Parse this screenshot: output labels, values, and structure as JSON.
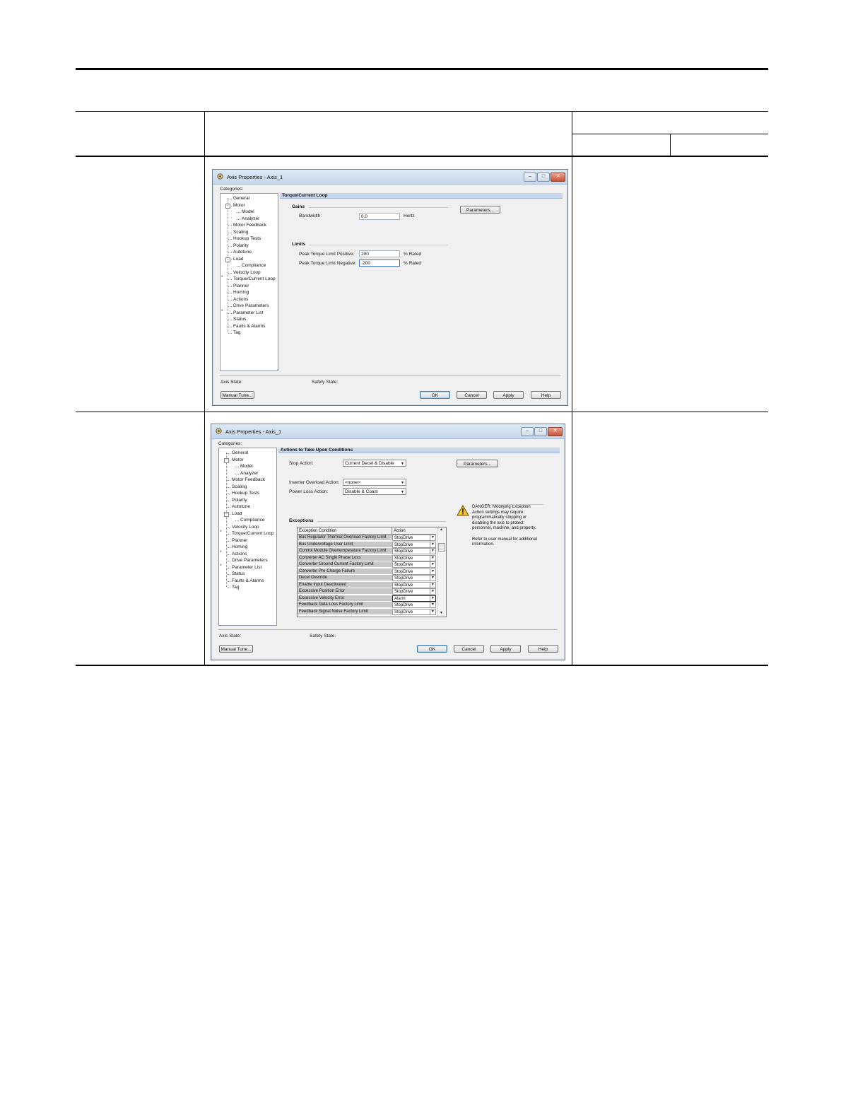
{
  "dialog1": {
    "title": "Axis Properties - Axis_1",
    "categories_label": "Categories:",
    "tree": [
      {
        "label": "General",
        "level": 1
      },
      {
        "label": "Motor",
        "level": 1,
        "expander": "-"
      },
      {
        "label": "Model",
        "level": 2
      },
      {
        "label": "Analyzer",
        "level": 2
      },
      {
        "label": "Motor Feedback",
        "level": 1
      },
      {
        "label": "Scaling",
        "level": 1
      },
      {
        "label": "Hookup Tests",
        "level": 1
      },
      {
        "label": "Polarity",
        "level": 1
      },
      {
        "label": "Autotune",
        "level": 1
      },
      {
        "label": "Load",
        "level": 1,
        "expander": "-"
      },
      {
        "label": "Compliance",
        "level": 2
      },
      {
        "label": "Velocity Loop",
        "level": 1
      },
      {
        "label": "Torque/Current Loop",
        "level": 1,
        "star": true
      },
      {
        "label": "Planner",
        "level": 1
      },
      {
        "label": "Homing",
        "level": 1
      },
      {
        "label": "Actions",
        "level": 1
      },
      {
        "label": "Drive Parameters",
        "level": 1
      },
      {
        "label": "Parameter List",
        "level": 1,
        "star": true
      },
      {
        "label": "Status",
        "level": 1
      },
      {
        "label": "Faults & Alarms",
        "level": 1
      },
      {
        "label": "Tag",
        "level": 1
      }
    ],
    "section_title": "Torque/Current Loop",
    "gains_label": "Gains",
    "bandwidth_label": "Bandwidth:",
    "bandwidth_value": "0.0",
    "bandwidth_unit": "Hertz",
    "parameters_button": "Parameters...",
    "limits_label": "Limits",
    "peak_pos_label": "Peak Torque Limit Positive:",
    "peak_pos_value": "200",
    "peak_pos_unit": "% Rated",
    "peak_neg_label": "Peak Torque Limit Negative:",
    "peak_neg_value": "-200",
    "peak_neg_unit": "% Rated",
    "axis_state_label": "Axis State:",
    "safety_state_label": "Safety State:",
    "manual_tune_button": "Manual Tune...",
    "ok_button": "OK",
    "cancel_button": "Cancel",
    "apply_button": "Apply",
    "help_button": "Help"
  },
  "dialog2": {
    "title": "Axis Properties - Axis_1",
    "categories_label": "Categories:",
    "tree": [
      {
        "label": "General",
        "level": 1
      },
      {
        "label": "Motor",
        "level": 1,
        "expander": "-"
      },
      {
        "label": "Model",
        "level": 2
      },
      {
        "label": "Analyzer",
        "level": 2
      },
      {
        "label": "Motor Feedback",
        "level": 1
      },
      {
        "label": "Scaling",
        "level": 1
      },
      {
        "label": "Hookup Tests",
        "level": 1
      },
      {
        "label": "Polarity",
        "level": 1
      },
      {
        "label": "Autotune",
        "level": 1
      },
      {
        "label": "Load",
        "level": 1,
        "expander": "-"
      },
      {
        "label": "Compliance",
        "level": 2
      },
      {
        "label": "Velocity Loop",
        "level": 1
      },
      {
        "label": "Torque/Current Loop",
        "level": 1,
        "star": true
      },
      {
        "label": "Planner",
        "level": 1
      },
      {
        "label": "Homing",
        "level": 1
      },
      {
        "label": "Actions",
        "level": 1,
        "star": true
      },
      {
        "label": "Drive Parameters",
        "level": 1
      },
      {
        "label": "Parameter List",
        "level": 1,
        "star": true
      },
      {
        "label": "Status",
        "level": 1
      },
      {
        "label": "Faults & Alarms",
        "level": 1
      },
      {
        "label": "Tag",
        "level": 1
      }
    ],
    "section_title": "Actions to Take Upon Conditions",
    "stop_action_label": "Stop Action:",
    "stop_action_value": "Current Decel & Disable",
    "parameters_button": "Parameters...",
    "inverter_overload_label": "Inverter Overload Action:",
    "inverter_overload_value": "<none>",
    "power_loss_label": "Power Loss Action:",
    "power_loss_value": "Disable & Coast",
    "exceptions_label": "Exceptions",
    "table_header": [
      "Exception Condition",
      "Action"
    ],
    "exceptions": [
      {
        "condition": "Bus Regulator Thermal Overload Factory Limit",
        "action": "StopDrive"
      },
      {
        "condition": "Bus Undervoltage User Limit",
        "action": "StopDrive"
      },
      {
        "condition": "Control Module Overtemperature Factory Limit",
        "action": "StopDrive"
      },
      {
        "condition": "Converter AC Single Phase Loss",
        "action": "StopDrive"
      },
      {
        "condition": "Converter Ground Current Factory Limit",
        "action": "StopDrive"
      },
      {
        "condition": "Converter Pre-Charge Failure",
        "action": "StopDrive"
      },
      {
        "condition": "Decel Override",
        "action": "StopDrive"
      },
      {
        "condition": "Enable Input Deactivated",
        "action": "StopDrive"
      },
      {
        "condition": "Excessive Position Error",
        "action": "StopDrive"
      },
      {
        "condition": "Excessive Velocity Error",
        "action": "Alarm"
      },
      {
        "condition": "Feedback Data Loss Factory Limit",
        "action": "StopDrive"
      },
      {
        "condition": "Feedback Signal Noise Factory Limit",
        "action": "StopDrive"
      }
    ],
    "danger_lines": [
      "DANGER: Modifying Exception",
      "Action settings may require",
      "programmatically stopping or",
      "disabling the axis to protect",
      "personnel, machine, and property.",
      "",
      "Refer to user manual for additional",
      "information."
    ],
    "axis_state_label": "Axis State:",
    "safety_state_label": "Safety State:",
    "manual_tune_button": "Manual Tune...",
    "ok_button": "OK",
    "cancel_button": "Cancel",
    "apply_button": "Apply",
    "help_button": "Help"
  }
}
